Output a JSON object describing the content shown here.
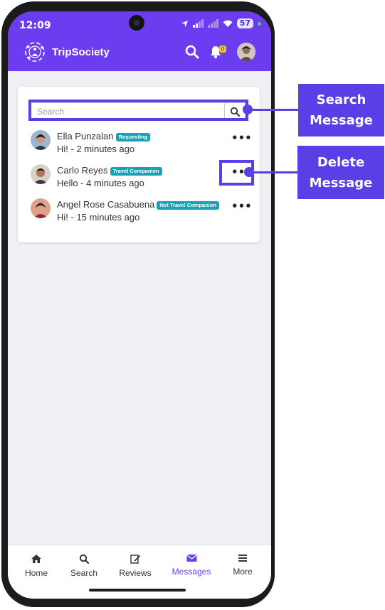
{
  "status_bar": {
    "time": "12:09",
    "battery": "57"
  },
  "app_bar": {
    "title": "TripSociety",
    "notification_count": "0"
  },
  "search": {
    "placeholder": "Search"
  },
  "messages": [
    {
      "name": "Ella Punzalan",
      "badge": "Requesting",
      "preview": "Hi! - 2 minutes ago"
    },
    {
      "name": "Carlo Reyes",
      "badge": "Travel Companion",
      "preview": "Hello - 4 minutes ago"
    },
    {
      "name": "Angel Rose Casabuena",
      "badge": "Not Travel Companion",
      "preview": "Hi! - 15 minutes ago"
    }
  ],
  "more_glyph": "•••",
  "bottom_nav": [
    {
      "label": "Home",
      "icon": "home-icon"
    },
    {
      "label": "Search",
      "icon": "search-icon"
    },
    {
      "label": "Reviews",
      "icon": "edit-icon"
    },
    {
      "label": "Messages",
      "icon": "envelope-icon"
    },
    {
      "label": "More",
      "icon": "menu-icon"
    }
  ],
  "annotations": {
    "search_callout": "Search Message",
    "delete_callout": "Delete Message"
  },
  "colors": {
    "brand": "#6c3df0",
    "annotation": "#5a3ee6",
    "badge": "#17a2b8"
  }
}
